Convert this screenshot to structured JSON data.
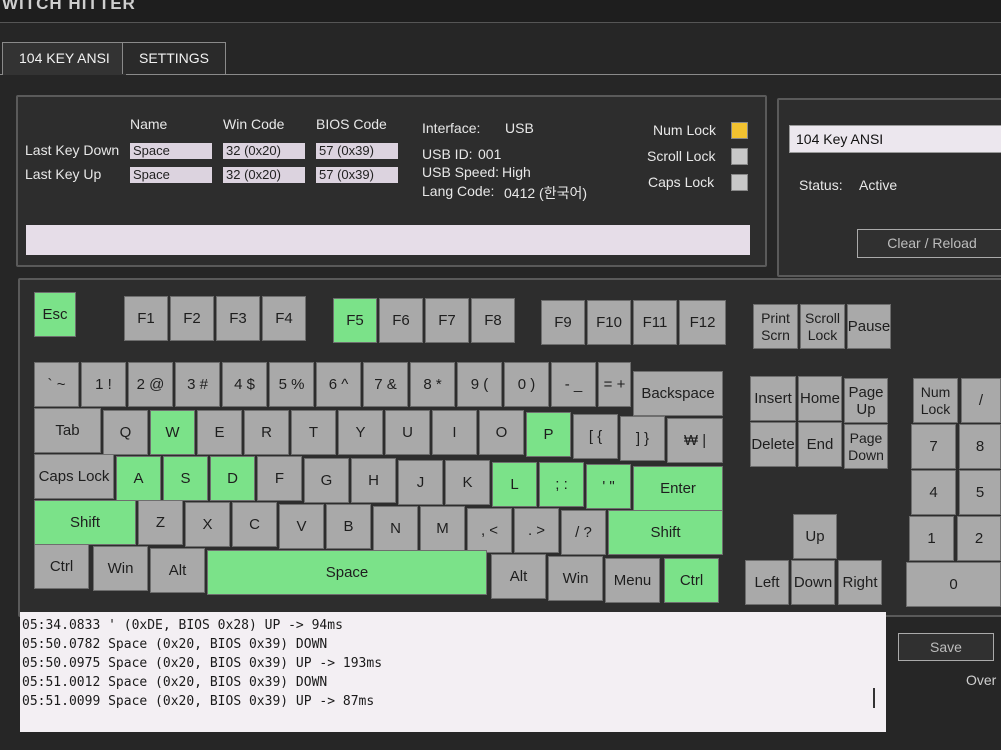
{
  "app": {
    "title": "WITCH HITTER"
  },
  "tabs": [
    {
      "label": "104 KEY ANSI",
      "active": true
    },
    {
      "label": "SETTINGS",
      "active": false
    }
  ],
  "info": {
    "headers": {
      "name": "Name",
      "win_code": "Win Code",
      "bios_code": "BIOS Code"
    },
    "last_key_down": {
      "label": "Last Key Down",
      "name": "Space",
      "win": "32 (0x20)",
      "bios": "57 (0x39)"
    },
    "last_key_up": {
      "label": "Last Key Up",
      "name": "Space",
      "win": "32 (0x20)",
      "bios": "57 (0x39)"
    },
    "interface": {
      "label": "Interface:",
      "value": "USB"
    },
    "usb_id": {
      "label": "USB ID:",
      "value": "001"
    },
    "usb_speed": {
      "label": "USB Speed:",
      "value": "High"
    },
    "lang_code": {
      "label": "Lang Code:",
      "value": "0412 (한국어)"
    },
    "locks": [
      {
        "label": "Num Lock",
        "color": "#f2c230"
      },
      {
        "label": "Scroll Lock",
        "color": "#c8c8c8"
      },
      {
        "label": "Caps Lock",
        "color": "#c8c8c8"
      }
    ]
  },
  "side": {
    "layout_value": "104 Key ANSI",
    "status_label": "Status:",
    "status_value": "Active",
    "clear_reload": "Clear / Reload",
    "save": "Save",
    "overwrite": "Over"
  },
  "colors": {
    "pressed": "#7be289",
    "idle": "#a9a9a9",
    "num_lock_on": "#f2c230"
  },
  "keyboard": {
    "keys": [
      {
        "id": "esc",
        "label": "Esc",
        "on": true
      },
      {
        "id": "f1",
        "label": "F1",
        "on": false
      },
      {
        "id": "f2",
        "label": "F2",
        "on": false
      },
      {
        "id": "f3",
        "label": "F3",
        "on": false
      },
      {
        "id": "f4",
        "label": "F4",
        "on": false
      },
      {
        "id": "f5",
        "label": "F5",
        "on": true
      },
      {
        "id": "f6",
        "label": "F6",
        "on": false
      },
      {
        "id": "f7",
        "label": "F7",
        "on": false
      },
      {
        "id": "f8",
        "label": "F8",
        "on": false
      },
      {
        "id": "f9",
        "label": "F9",
        "on": false
      },
      {
        "id": "f10",
        "label": "F10",
        "on": false
      },
      {
        "id": "f11",
        "label": "F11",
        "on": false
      },
      {
        "id": "f12",
        "label": "F12",
        "on": false
      },
      {
        "id": "print-scrn",
        "label": "Print Scrn",
        "on": false
      },
      {
        "id": "scroll-lock",
        "label": "Scroll Lock",
        "on": false
      },
      {
        "id": "pause",
        "label": "Pause",
        "on": false
      },
      {
        "id": "backtick",
        "label": "` ~",
        "on": false
      },
      {
        "id": "1",
        "label": "1 !",
        "on": false
      },
      {
        "id": "2",
        "label": "2 @",
        "on": false
      },
      {
        "id": "3",
        "label": "3 #",
        "on": false
      },
      {
        "id": "4",
        "label": "4 $",
        "on": false
      },
      {
        "id": "5",
        "label": "5 %",
        "on": false
      },
      {
        "id": "6",
        "label": "6 ^",
        "on": false
      },
      {
        "id": "7",
        "label": "7 &",
        "on": false
      },
      {
        "id": "8",
        "label": "8 *",
        "on": false
      },
      {
        "id": "9",
        "label": "9 (",
        "on": false
      },
      {
        "id": "0",
        "label": "0 )",
        "on": false
      },
      {
        "id": "minus",
        "label": "- _",
        "on": false
      },
      {
        "id": "equals",
        "label": "= +",
        "on": false
      },
      {
        "id": "backspace",
        "label": "Backspace",
        "on": false
      },
      {
        "id": "tab",
        "label": "Tab",
        "on": false
      },
      {
        "id": "q",
        "label": "Q",
        "on": false
      },
      {
        "id": "w",
        "label": "W",
        "on": true
      },
      {
        "id": "e",
        "label": "E",
        "on": false
      },
      {
        "id": "r",
        "label": "R",
        "on": false
      },
      {
        "id": "t",
        "label": "T",
        "on": false
      },
      {
        "id": "y",
        "label": "Y",
        "on": false
      },
      {
        "id": "u",
        "label": "U",
        "on": false
      },
      {
        "id": "i",
        "label": "I",
        "on": false
      },
      {
        "id": "o",
        "label": "O",
        "on": false
      },
      {
        "id": "p",
        "label": "P",
        "on": true
      },
      {
        "id": "lbracket",
        "label": "[ {",
        "on": false
      },
      {
        "id": "rbracket",
        "label": "] }",
        "on": false
      },
      {
        "id": "won",
        "label": "₩ |",
        "on": false
      },
      {
        "id": "caps-lock",
        "label": "Caps Lock",
        "on": false
      },
      {
        "id": "a",
        "label": "A",
        "on": true
      },
      {
        "id": "s",
        "label": "S",
        "on": true
      },
      {
        "id": "d",
        "label": "D",
        "on": true
      },
      {
        "id": "f",
        "label": "F",
        "on": false
      },
      {
        "id": "g",
        "label": "G",
        "on": false
      },
      {
        "id": "h",
        "label": "H",
        "on": false
      },
      {
        "id": "j",
        "label": "J",
        "on": false
      },
      {
        "id": "k",
        "label": "K",
        "on": false
      },
      {
        "id": "l",
        "label": "L",
        "on": true
      },
      {
        "id": "semicolon",
        "label": "; :",
        "on": true
      },
      {
        "id": "quote",
        "label": "' \"",
        "on": true
      },
      {
        "id": "enter",
        "label": "Enter",
        "on": true
      },
      {
        "id": "lshift",
        "label": "Shift",
        "on": true
      },
      {
        "id": "z",
        "label": "Z",
        "on": false
      },
      {
        "id": "x",
        "label": "X",
        "on": false
      },
      {
        "id": "c",
        "label": "C",
        "on": false
      },
      {
        "id": "v",
        "label": "V",
        "on": false
      },
      {
        "id": "b",
        "label": "B",
        "on": false
      },
      {
        "id": "n",
        "label": "N",
        "on": false
      },
      {
        "id": "m",
        "label": "M",
        "on": false
      },
      {
        "id": "comma",
        "label": ", <",
        "on": false
      },
      {
        "id": "period",
        "label": ". >",
        "on": false
      },
      {
        "id": "slash",
        "label": "/ ?",
        "on": false
      },
      {
        "id": "rshift",
        "label": "Shift",
        "on": true
      },
      {
        "id": "lctrl",
        "label": "Ctrl",
        "on": false
      },
      {
        "id": "lwin",
        "label": "Win",
        "on": false
      },
      {
        "id": "lalt",
        "label": "Alt",
        "on": false
      },
      {
        "id": "space",
        "label": "Space",
        "on": true
      },
      {
        "id": "ralt",
        "label": "Alt",
        "on": false
      },
      {
        "id": "rwin",
        "label": "Win",
        "on": false
      },
      {
        "id": "menu",
        "label": "Menu",
        "on": false
      },
      {
        "id": "rctrl",
        "label": "Ctrl",
        "on": true
      },
      {
        "id": "insert",
        "label": "Insert",
        "on": false
      },
      {
        "id": "home",
        "label": "Home",
        "on": false
      },
      {
        "id": "page-up",
        "label": "Page Up",
        "on": false
      },
      {
        "id": "delete",
        "label": "Delete",
        "on": false
      },
      {
        "id": "end",
        "label": "End",
        "on": false
      },
      {
        "id": "page-down",
        "label": "Page Down",
        "on": false
      },
      {
        "id": "up",
        "label": "Up",
        "on": false
      },
      {
        "id": "left",
        "label": "Left",
        "on": false
      },
      {
        "id": "down",
        "label": "Down",
        "on": false
      },
      {
        "id": "right",
        "label": "Right",
        "on": false
      },
      {
        "id": "num-lock",
        "label": "Num Lock",
        "on": false
      },
      {
        "id": "num-slash",
        "label": "/",
        "on": false
      },
      {
        "id": "num-7",
        "label": "7",
        "on": false
      },
      {
        "id": "num-8",
        "label": "8",
        "on": false
      },
      {
        "id": "num-4",
        "label": "4",
        "on": false
      },
      {
        "id": "num-5",
        "label": "5",
        "on": false
      },
      {
        "id": "num-1",
        "label": "1",
        "on": false
      },
      {
        "id": "num-2",
        "label": "2",
        "on": false
      },
      {
        "id": "num-0",
        "label": "0",
        "on": false
      }
    ]
  },
  "log": [
    "05:34.0833 ' (0xDE, BIOS 0x28) UP -> 94ms",
    "05:50.0782 Space (0x20, BIOS 0x39) DOWN",
    "05:50.0975 Space (0x20, BIOS 0x39) UP -> 193ms",
    "05:51.0012 Space (0x20, BIOS 0x39) DOWN",
    "05:51.0099 Space (0x20, BIOS 0x39) UP -> 87ms"
  ]
}
